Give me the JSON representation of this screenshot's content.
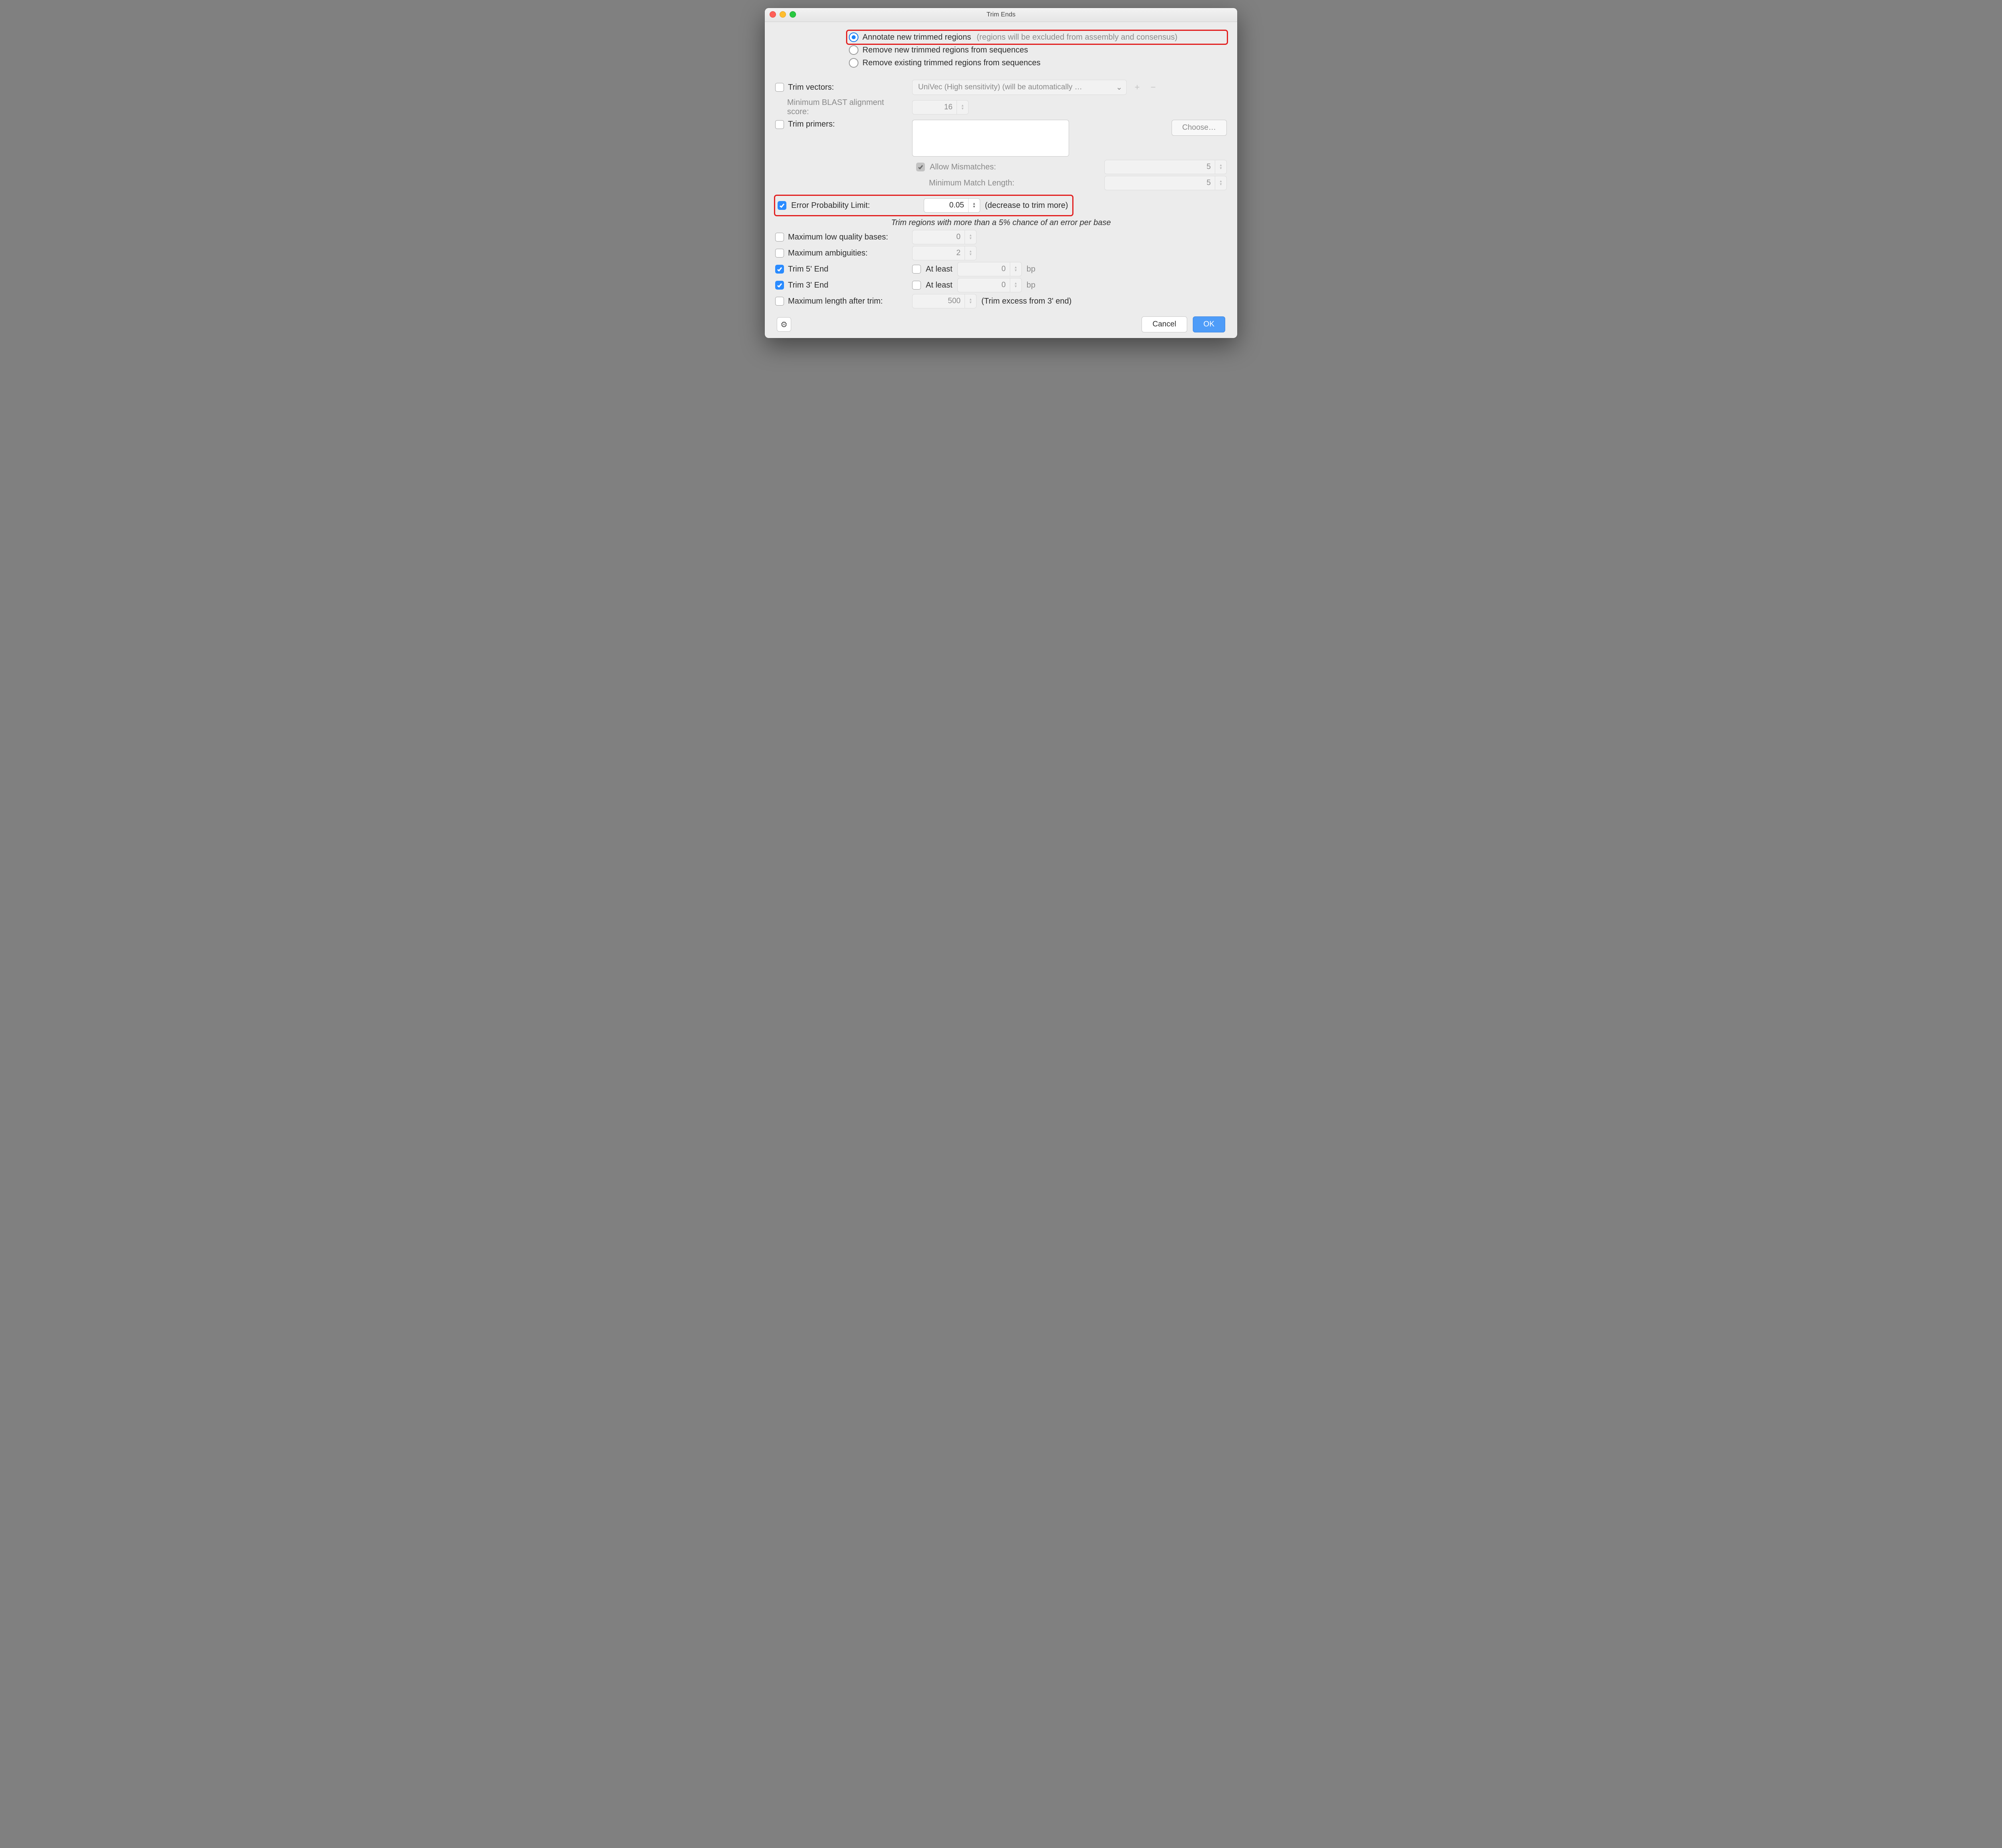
{
  "window": {
    "title": "Trim Ends"
  },
  "radios": {
    "annotate": {
      "label": "Annotate new trimmed regions",
      "hint": "(regions will be excluded from assembly and consensus)",
      "selected": true
    },
    "remove_new": {
      "label": "Remove new trimmed regions from sequences",
      "selected": false
    },
    "remove_existing": {
      "label": "Remove existing trimmed regions from sequences",
      "selected": false
    }
  },
  "trim_vectors": {
    "label": "Trim vectors:",
    "checked": false,
    "db_display": "UniVec (High sensitivity) (will be automatically …",
    "plus": "+",
    "minus": "−"
  },
  "blast_score": {
    "label": "Minimum BLAST alignment score:",
    "value": "16"
  },
  "trim_primers": {
    "label": "Trim primers:",
    "checked": false,
    "choose": "Choose…",
    "allow_mismatches": {
      "label": "Allow Mismatches:",
      "checked": true,
      "value": "5"
    },
    "min_match": {
      "label": "Minimum Match Length:",
      "value": "5"
    }
  },
  "error_limit": {
    "label": "Error Probability Limit:",
    "checked": true,
    "value": "0.05",
    "hint": "(decrease to trim more)"
  },
  "error_hint_line": "Trim regions with more than a 5% chance of an error per base",
  "max_lowq": {
    "label": "Maximum low quality bases:",
    "checked": false,
    "value": "0"
  },
  "max_ambig": {
    "label": "Maximum ambiguities:",
    "checked": false,
    "value": "2"
  },
  "trim5": {
    "label": "Trim 5' End",
    "checked": true,
    "atleast_checked": false,
    "atleast_label": "At least",
    "atleast_value": "0",
    "unit": "bp"
  },
  "trim3": {
    "label": "Trim 3' End",
    "checked": true,
    "atleast_checked": false,
    "atleast_label": "At least",
    "atleast_value": "0",
    "unit": "bp"
  },
  "max_len": {
    "label": "Maximum length after trim:",
    "checked": false,
    "value": "500",
    "hint": "(Trim excess from 3' end)"
  },
  "buttons": {
    "cancel": "Cancel",
    "ok": "OK"
  }
}
